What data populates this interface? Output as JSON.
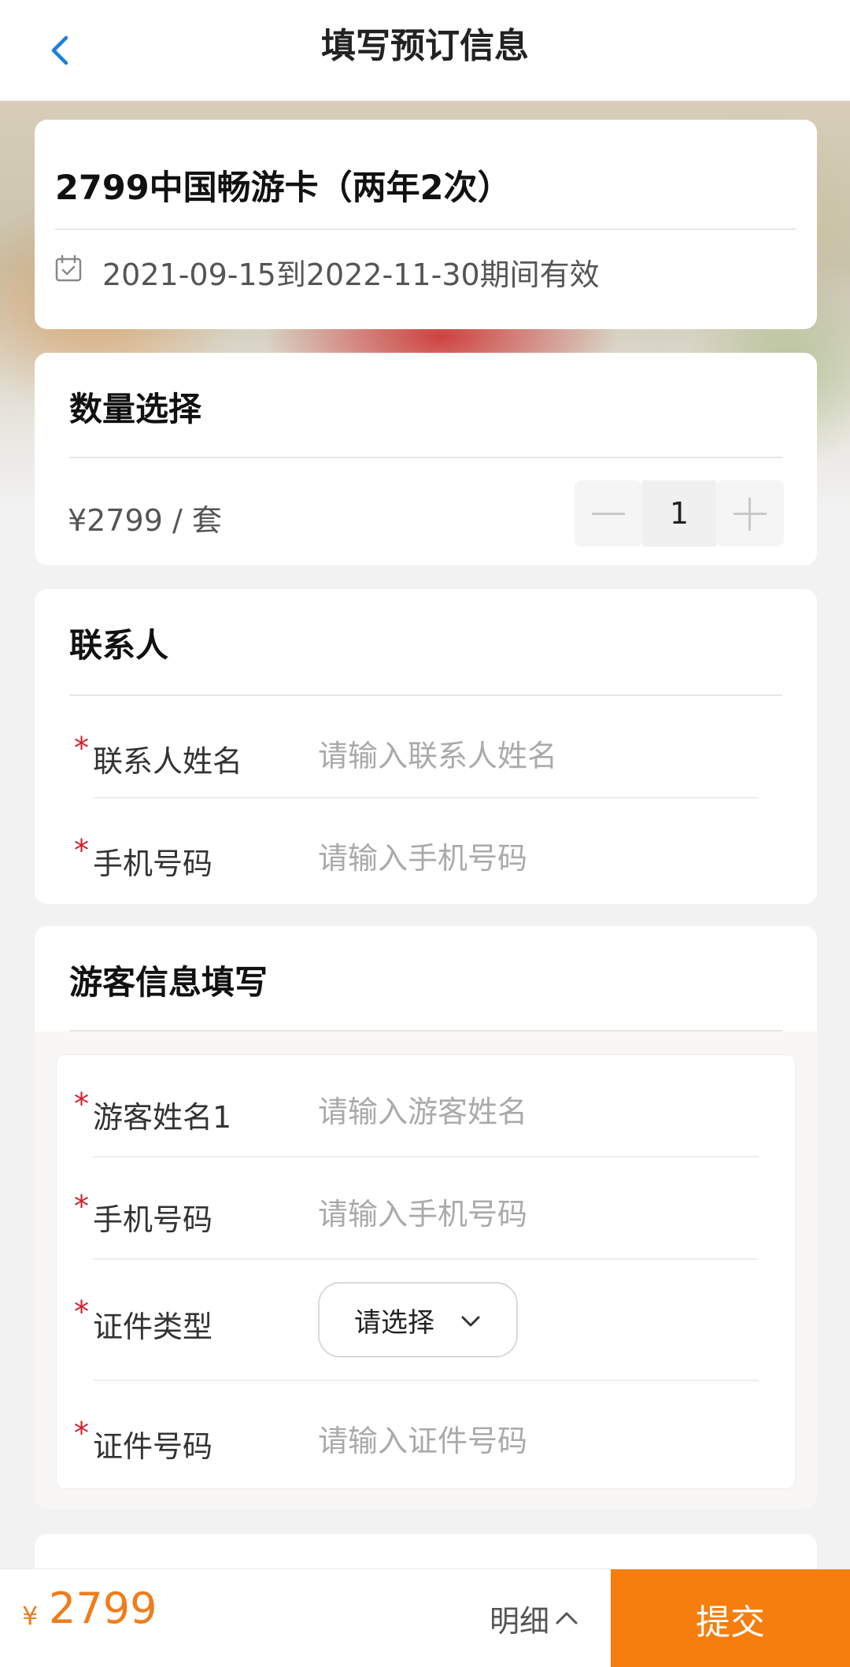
{
  "header": {
    "title": "填写预订信息",
    "back_icon": "chevron-left-icon"
  },
  "product": {
    "name": "2799中国畅游卡（两年2次）",
    "validity": "2021-09-15到2022-11-30期间有效",
    "validity_icon": "calendar-check-icon"
  },
  "quantity": {
    "section_title": "数量选择",
    "price_unit": "¥2799 / 套",
    "value": "1",
    "minus_icon": "minus-icon",
    "plus_icon": "plus-icon"
  },
  "contact": {
    "section_title": "联系人",
    "required_mark": "*",
    "fields": [
      {
        "label": "联系人姓名",
        "placeholder": "请输入联系人姓名",
        "value": ""
      },
      {
        "label": "手机号码",
        "placeholder": "请输入手机号码",
        "value": ""
      }
    ]
  },
  "tourist": {
    "section_title": "游客信息填写",
    "required_mark": "*",
    "fields": [
      {
        "label": "游客姓名1",
        "placeholder": "请输入游客姓名",
        "value": ""
      },
      {
        "label": "手机号码",
        "placeholder": "请输入手机号码",
        "value": ""
      },
      {
        "label": "证件类型",
        "select_text": "请选择",
        "select_icon": "chevron-down-icon"
      },
      {
        "label": "证件号码",
        "placeholder": "请输入证件号码",
        "value": ""
      }
    ]
  },
  "footer": {
    "currency": "¥",
    "total": "2799",
    "detail_label": "明细",
    "detail_icon": "chevron-up-icon",
    "submit_label": "提交"
  },
  "colors": {
    "accent": "#f57e0f",
    "price": "#f07c1a",
    "required": "#d0202a",
    "back_icon": "#1e7fd8"
  }
}
